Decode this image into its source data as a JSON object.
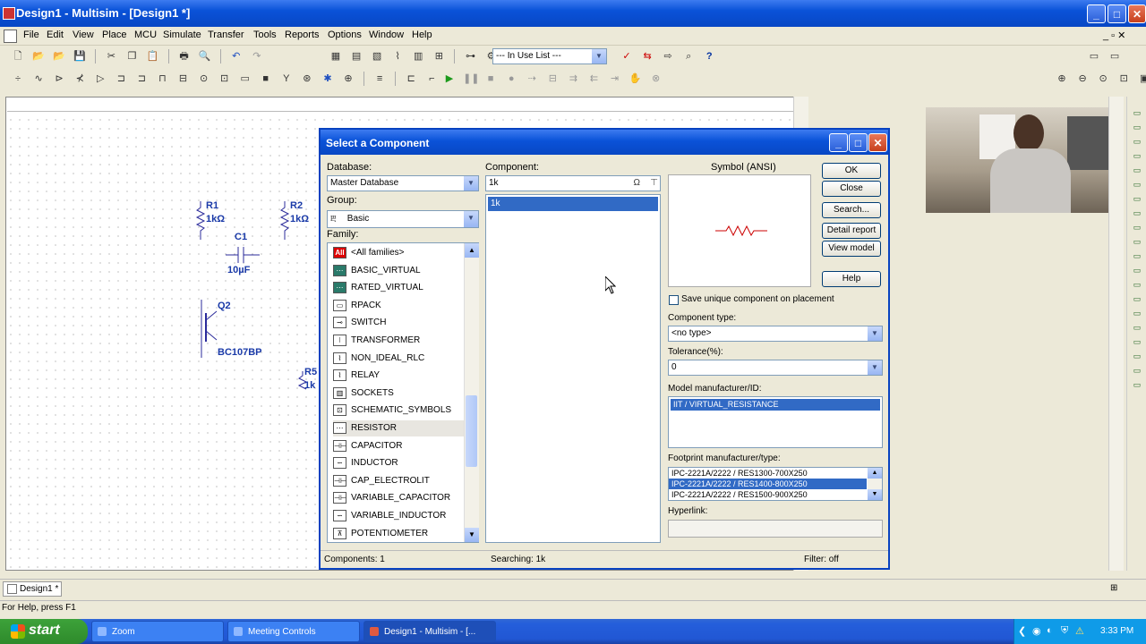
{
  "window": {
    "title": "Design1 - Multisim - [Design1 *]"
  },
  "menu": [
    "File",
    "Edit",
    "View",
    "Place",
    "MCU",
    "Simulate",
    "Transfer",
    "Tools",
    "Reports",
    "Options",
    "Window",
    "Help"
  ],
  "toolbar": {
    "in_use_list": "--- In Use List ---"
  },
  "schematic": {
    "r1_ref": "R1",
    "r1_val": "1kΩ",
    "r2_ref": "R2",
    "r2_val": "1kΩ",
    "c1_ref": "C1",
    "c1_val": "10µF",
    "q2_ref": "Q2",
    "q2_val": "BC107BP",
    "r5_ref": "R5",
    "r5_val": "1k"
  },
  "dialog": {
    "title": "Select a Component",
    "database_label": "Database:",
    "database_value": "Master Database",
    "group_label": "Group:",
    "group_value": "Basic",
    "group_icon": "Ⰱ",
    "family_label": "Family:",
    "families": [
      {
        "icon": "All",
        "name": "<All families>"
      },
      {
        "icon": "⋯",
        "name": "BASIC_VIRTUAL"
      },
      {
        "icon": "⋯",
        "name": "RATED_VIRTUAL"
      },
      {
        "icon": "▭",
        "name": "RPACK"
      },
      {
        "icon": "⊸",
        "name": "SWITCH"
      },
      {
        "icon": "⦚",
        "name": "TRANSFORMER"
      },
      {
        "icon": "⌇",
        "name": "NON_IDEAL_RLC"
      },
      {
        "icon": "⌇",
        "name": "RELAY"
      },
      {
        "icon": "▥",
        "name": "SOCKETS"
      },
      {
        "icon": "⊡",
        "name": "SCHEMATIC_SYMBOLS"
      },
      {
        "icon": "⋯",
        "name": "RESISTOR"
      },
      {
        "icon": "⊣⊢",
        "name": "CAPACITOR"
      },
      {
        "icon": "∽",
        "name": "INDUCTOR"
      },
      {
        "icon": "⊣⊢",
        "name": "CAP_ELECTROLIT"
      },
      {
        "icon": "⊣⊢",
        "name": "VARIABLE_CAPACITOR"
      },
      {
        "icon": "∽",
        "name": "VARIABLE_INDUCTOR"
      },
      {
        "icon": "⊼",
        "name": "POTENTIOMETER"
      }
    ],
    "component_label": "Component:",
    "component_value": "1k",
    "component_list": [
      "1k"
    ],
    "symbol_label": "Symbol (ANSI)",
    "buttons": {
      "ok": "OK",
      "close": "Close",
      "search": "Search...",
      "detail": "Detail report",
      "view_model": "View model",
      "help": "Help"
    },
    "save_unique_label": "Save unique component on placement",
    "component_type_label": "Component type:",
    "component_type_value": "<no type>",
    "tolerance_label": "Tolerance(%):",
    "tolerance_value": "0",
    "model_label": "Model manufacturer/ID:",
    "model_items": [
      "IIT / VIRTUAL_RESISTANCE"
    ],
    "footprint_label": "Footprint manufacturer/type:",
    "footprint_items": [
      "IPC-2221A/2222 / RES1300-700X250",
      "IPC-2221A/2222 / RES1400-800X250",
      "IPC-2221A/2222 / RES1500-900X250"
    ],
    "hyperlink_label": "Hyperlink:",
    "status_components": "Components: 1",
    "status_searching": "Searching: 1k",
    "status_filter": "Filter: off"
  },
  "tabs": {
    "design": "Design1 *"
  },
  "statusbar": {
    "help": "For Help, press F1"
  },
  "taskbar": {
    "start": "start",
    "items": [
      "Zoom",
      "Meeting Controls",
      "Design1 - Multisim - [..."
    ],
    "clock": "3:33 PM"
  }
}
